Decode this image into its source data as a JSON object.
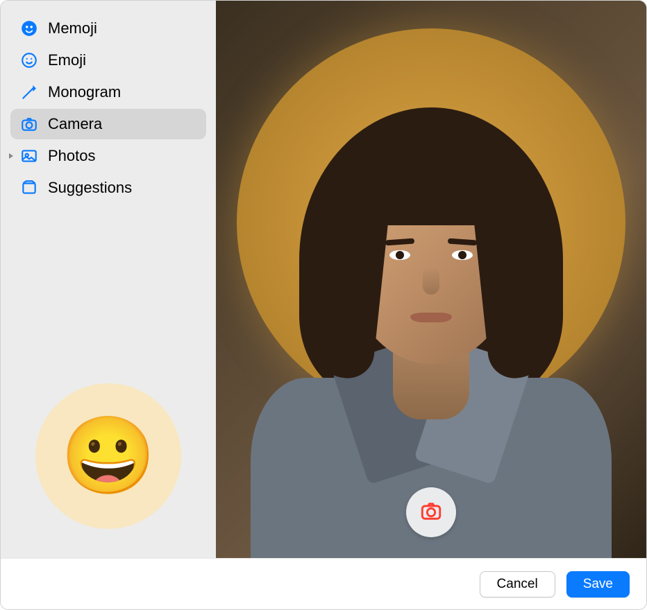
{
  "sidebar": {
    "items": [
      {
        "label": "Memoji",
        "icon": "memoji-icon",
        "selected": false
      },
      {
        "label": "Emoji",
        "icon": "emoji-icon",
        "selected": false
      },
      {
        "label": "Monogram",
        "icon": "monogram-icon",
        "selected": false
      },
      {
        "label": "Camera",
        "icon": "camera-icon",
        "selected": true
      },
      {
        "label": "Photos",
        "icon": "photos-icon",
        "selected": false,
        "expandable": true
      },
      {
        "label": "Suggestions",
        "icon": "suggestions-icon",
        "selected": false
      }
    ],
    "preview_emoji": "😀"
  },
  "footer": {
    "cancel_label": "Cancel",
    "save_label": "Save"
  },
  "colors": {
    "accent": "#0a7aff",
    "capture": "#ff3b30"
  }
}
